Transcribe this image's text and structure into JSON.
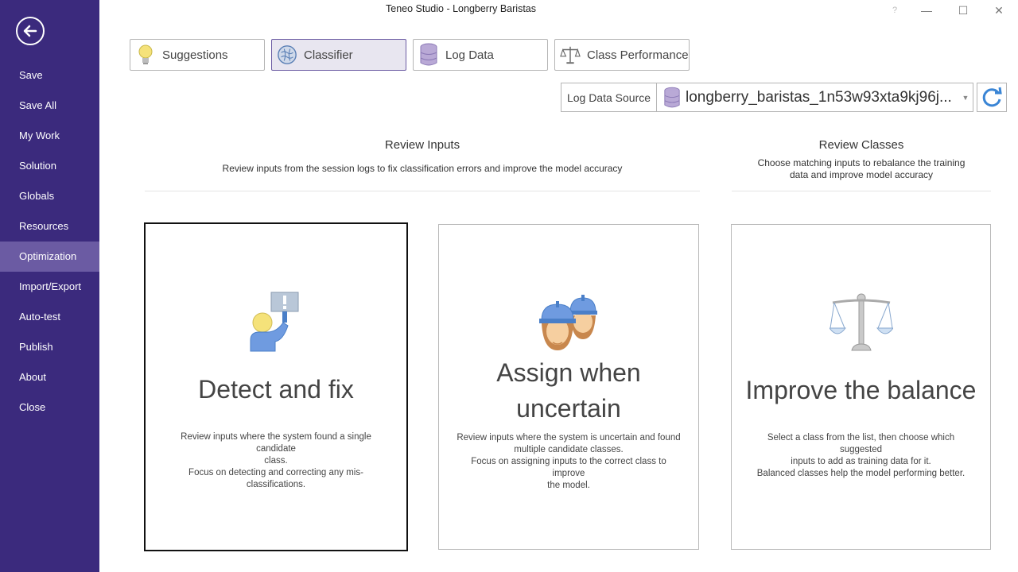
{
  "window": {
    "title": "Teneo Studio - Longberry Baristas",
    "help": "?",
    "minimize": "—",
    "maximize": "☐",
    "close": "✕"
  },
  "sidebar": {
    "items": [
      {
        "label": "Save"
      },
      {
        "label": "Save All"
      },
      {
        "label": "My Work"
      },
      {
        "label": "Solution"
      },
      {
        "label": "Globals"
      },
      {
        "label": "Resources"
      },
      {
        "label": "Optimization"
      },
      {
        "label": "Import/Export"
      },
      {
        "label": "Auto-test"
      },
      {
        "label": "Publish"
      },
      {
        "label": "About"
      },
      {
        "label": "Close"
      }
    ],
    "active": "Optimization"
  },
  "tabs": [
    {
      "label": "Suggestions",
      "icon": "lightbulb-icon"
    },
    {
      "label": "Classifier",
      "icon": "brain-icon"
    },
    {
      "label": "Log Data",
      "icon": "database-icon"
    },
    {
      "label": "Class Performance",
      "icon": "scales-icon"
    }
  ],
  "log_source": {
    "label": "Log Data Source",
    "value": "longberry_baristas_1n53w93xta9kj96j..."
  },
  "review_inputs": {
    "title": "Review Inputs",
    "desc": "Review inputs from the session logs to fix classification errors and improve the model accuracy"
  },
  "review_classes": {
    "title": "Review Classes",
    "desc_line1": "Choose matching inputs to rebalance the training",
    "desc_line2": "data and improve model accuracy"
  },
  "cards": [
    {
      "title": "Detect and fix",
      "desc_line1": "Review inputs where the system found a single candidate",
      "desc_line2": "class.",
      "desc_line3": "Focus on detecting and correcting any mis-classifications."
    },
    {
      "title_line1": "Assign when",
      "title_line2": "uncertain",
      "desc_line1": "Review inputs where the system is uncertain and found",
      "desc_line2": "multiple candidate classes.",
      "desc_line3": "Focus on assigning inputs to the correct class to improve",
      "desc_line4": "the model."
    },
    {
      "title": "Improve the balance",
      "desc_line1": "Select a class from the list, then choose which suggested",
      "desc_line2": "inputs to add as training data for it.",
      "desc_line3": "Balanced classes help the model performing better."
    }
  ],
  "colors": {
    "sidebar": "#3b2a7d",
    "sidebar_active": "#6b5ba3",
    "accent_blue": "#4a8bd6",
    "icon_purple": "#b9a9d6"
  }
}
